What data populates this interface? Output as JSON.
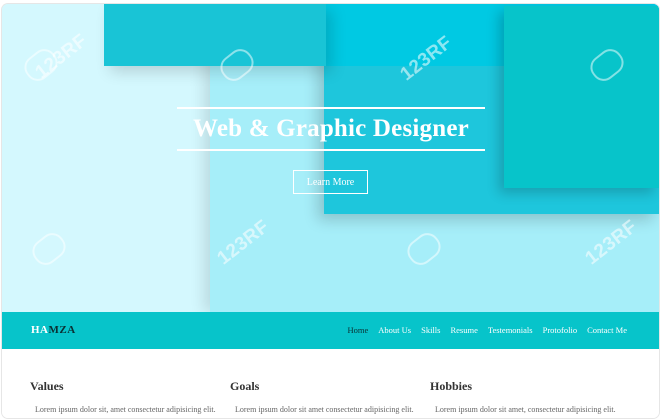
{
  "hero": {
    "title": "Web & Graphic Designer",
    "button_label": "Learn More",
    "colors": {
      "teal": "#07c4ca",
      "cyan": "#00daf0",
      "light": "#cdf6fd"
    },
    "watermarks": [
      "123RF",
      "123RF",
      "123RF",
      "123RF",
      "123RF"
    ]
  },
  "navbar": {
    "brand_part1": "HA",
    "brand_part2": "MZA",
    "items": [
      {
        "label": "Home"
      },
      {
        "label": "About Us"
      },
      {
        "label": "Skills"
      },
      {
        "label": "Resume"
      },
      {
        "label": "Testemonials"
      },
      {
        "label": "Protofolio"
      },
      {
        "label": "Contact Me"
      }
    ]
  },
  "sections": [
    {
      "heading": "Values",
      "text": "Lorem ipsum dolor sit, amet consectetur adipisicing elit."
    },
    {
      "heading": "Goals",
      "text": "Lorem ipsum dolor sit amet consectetur adipisicing elit."
    },
    {
      "heading": "Hobbies",
      "text": "Lorem ipsum dolor sit amet, consectetur adipisicing elit."
    }
  ]
}
